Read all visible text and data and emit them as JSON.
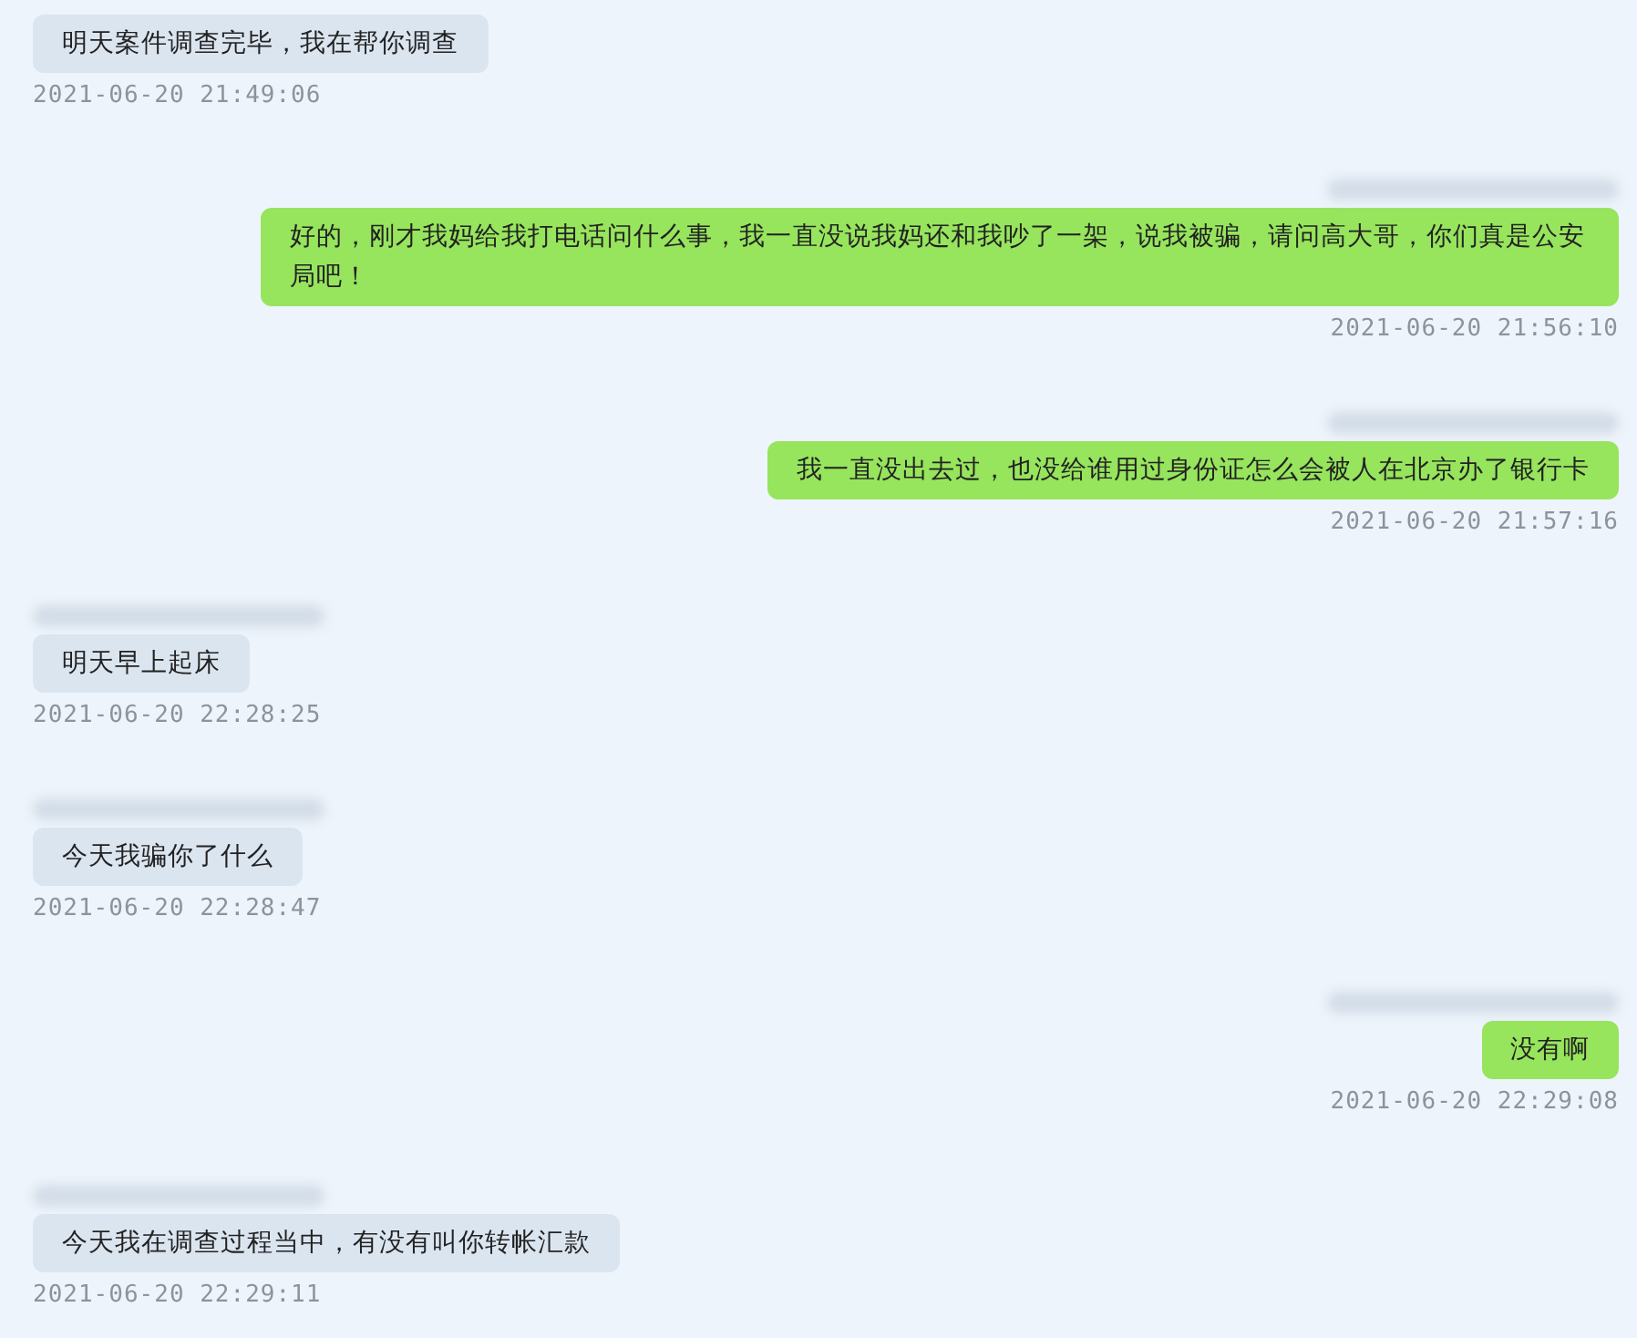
{
  "messages": [
    {
      "kind": "received",
      "text": "明天案件调查完毕，我在帮你调查",
      "time": "2021-06-20 21:49:06"
    },
    {
      "kind": "sent",
      "text": "好的，刚才我妈给我打电话问什么事，我一直没说我妈还和我吵了一架，说我被骗，请问高大哥，你们真是公安局吧！",
      "time": "2021-06-20 21:56:10"
    },
    {
      "kind": "sent",
      "text": "我一直没出去过，也没给谁用过身份证怎么会被人在北京办了银行卡",
      "time": "2021-06-20 21:57:16"
    },
    {
      "kind": "received",
      "text": "明天早上起床",
      "time": "2021-06-20 22:28:25"
    },
    {
      "kind": "received",
      "text": "今天我骗你了什么",
      "time": "2021-06-20 22:28:47"
    },
    {
      "kind": "sent",
      "text": "没有啊",
      "time": "2021-06-20 22:29:08"
    },
    {
      "kind": "received",
      "text": "今天我在调查过程当中，有没有叫你转帐汇款",
      "time": "2021-06-20 22:29:11"
    }
  ]
}
